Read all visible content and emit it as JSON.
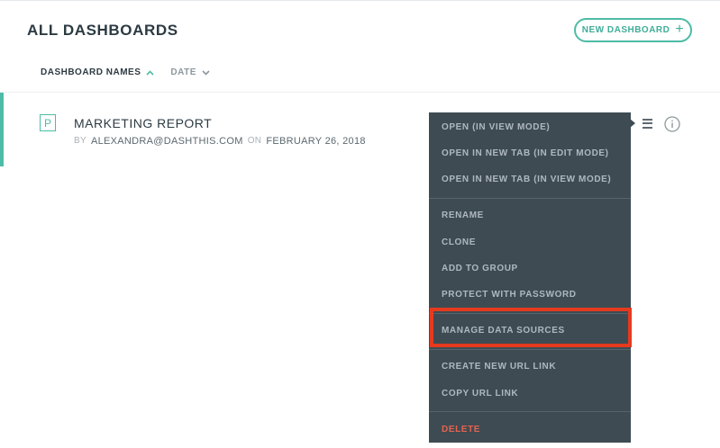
{
  "header": {
    "title": "ALL DASHBOARDS",
    "new_dashboard_label": "NEW DASHBOARD",
    "new_dashboard_icon": "plus-icon"
  },
  "sort": {
    "name_label": "DASHBOARD NAMES",
    "name_direction": "ascending",
    "date_label": "DATE",
    "date_direction": "descending"
  },
  "dashboards": [
    {
      "icon_letter": "P",
      "name": "MARKETING REPORT",
      "by_label": "BY",
      "author": "ALEXANDRA@DASHTHIS.COM",
      "on_label": "ON",
      "date": "FEBRUARY 26, 2018"
    }
  ],
  "context_menu": {
    "items": [
      "OPEN (IN VIEW MODE)",
      "OPEN IN NEW TAB (IN EDIT MODE)",
      "OPEN IN NEW TAB (IN VIEW MODE)",
      "RENAME",
      "CLONE",
      "ADD TO GROUP",
      "PROTECT WITH PASSWORD",
      "MANAGE DATA SOURCES",
      "CREATE NEW URL LINK",
      "COPY URL LINK",
      "DELETE"
    ],
    "highlighted_item": "MANAGE DATA SOURCES"
  },
  "colors": {
    "accent": "#4dbba6",
    "menu_background": "#3e4b53",
    "menu_text": "#aeb8be",
    "danger": "#e5634f",
    "highlight_border": "#e63a1e"
  }
}
